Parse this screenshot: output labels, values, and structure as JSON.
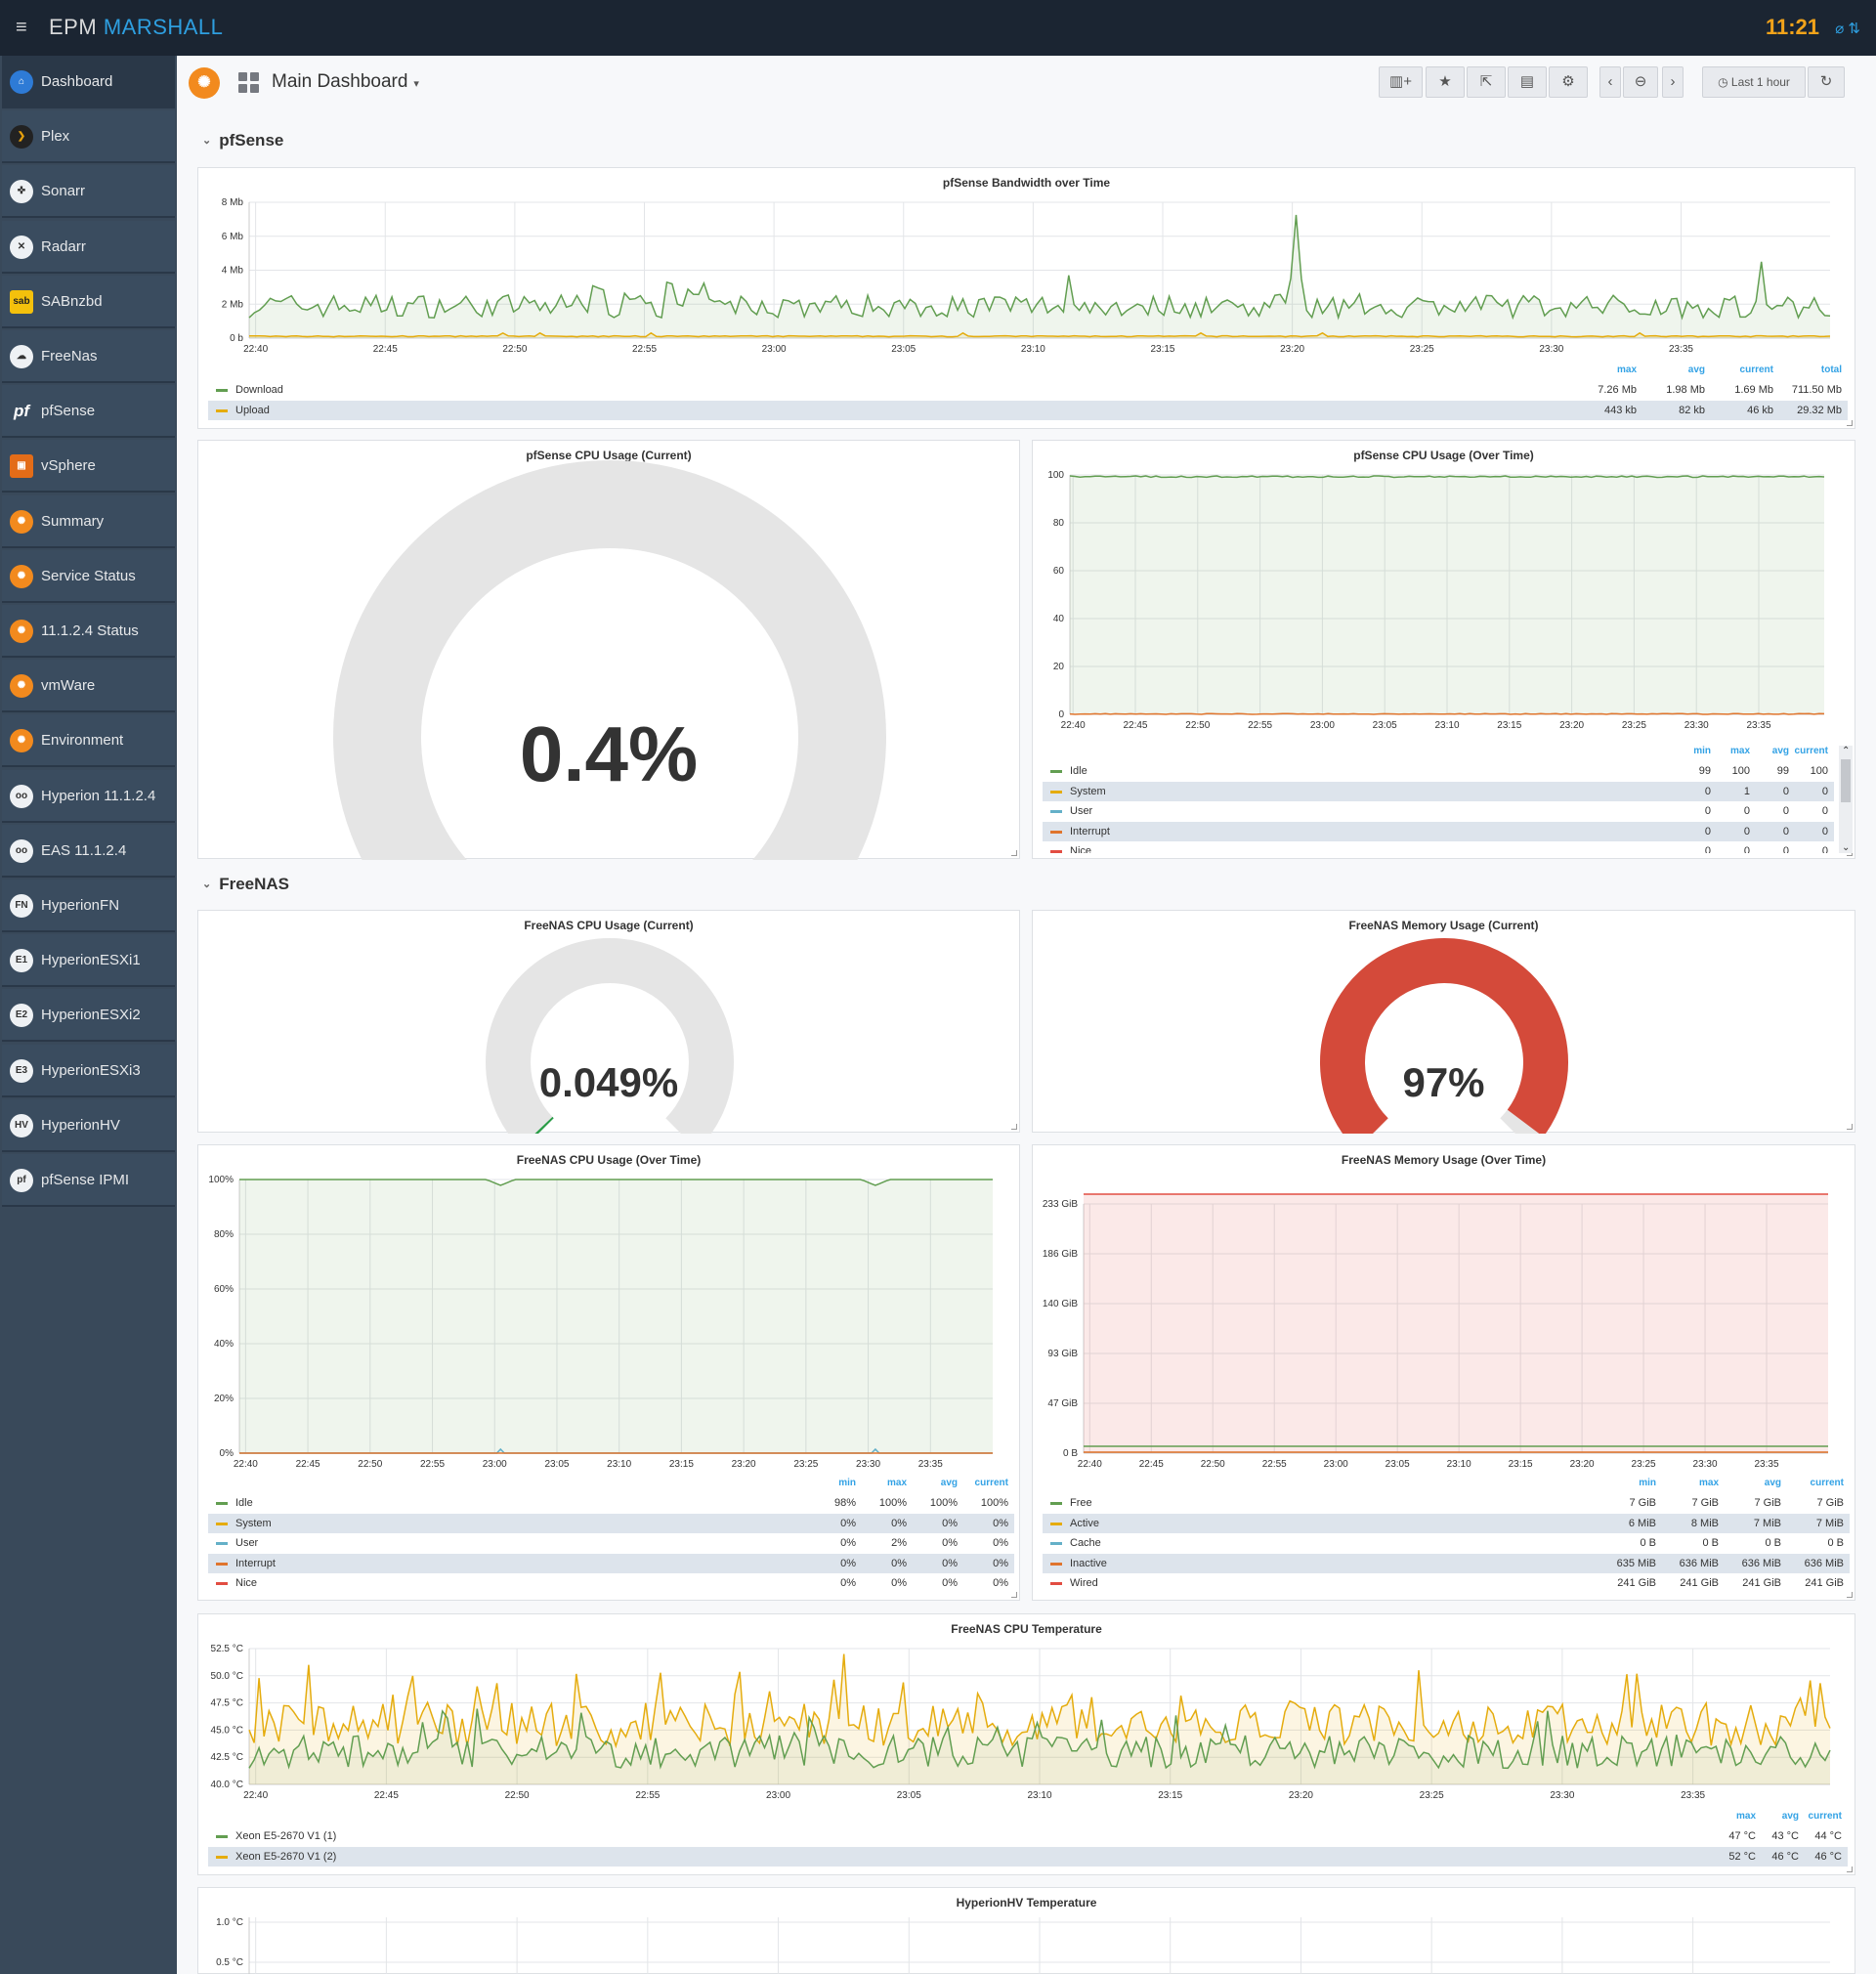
{
  "topbar": {
    "menu_icon": "hamburger-icon",
    "brand_part1": "EPM",
    "brand_part2": "MARSHALL",
    "clock": "11:21",
    "status_icons": "⌀ ⇅"
  },
  "sidebar": {
    "items": [
      {
        "label": "Dashboard",
        "icon": "home-icon",
        "icon_text": "⌂"
      },
      {
        "label": "Plex",
        "icon": "plex-icon",
        "icon_text": "❯"
      },
      {
        "label": "Sonarr",
        "icon": "sonarr-icon",
        "icon_text": "✜"
      },
      {
        "label": "Radarr",
        "icon": "radarr-icon",
        "icon_text": "✕"
      },
      {
        "label": "SABnzbd",
        "icon": "sabnzbd-icon",
        "icon_text": "sab"
      },
      {
        "label": "FreeNas",
        "icon": "freenas-icon",
        "icon_text": "☁"
      },
      {
        "label": "pfSense",
        "icon": "pfsense-icon",
        "icon_text": "pf"
      },
      {
        "label": "vSphere",
        "icon": "vsphere-icon",
        "icon_text": "▣"
      },
      {
        "label": "Summary",
        "icon": "grafana-icon",
        "icon_text": "✺"
      },
      {
        "label": "Service Status",
        "icon": "grafana-icon",
        "icon_text": "✺"
      },
      {
        "label": "11.1.2.4 Status",
        "icon": "grafana-icon",
        "icon_text": "✺"
      },
      {
        "label": "vmWare",
        "icon": "grafana-icon",
        "icon_text": "✺"
      },
      {
        "label": "Environment",
        "icon": "grafana-icon",
        "icon_text": "✺"
      },
      {
        "label": "Hyperion 11.1.2.4",
        "icon": "hyperion-icon",
        "icon_text": "oo"
      },
      {
        "label": "EAS 11.1.2.4",
        "icon": "eas-icon",
        "icon_text": "oo"
      },
      {
        "label": "HyperionFN",
        "icon": "ipmi-icon",
        "icon_text": "FN"
      },
      {
        "label": "HyperionESXi1",
        "icon": "ipmi-icon",
        "icon_text": "E1"
      },
      {
        "label": "HyperionESXi2",
        "icon": "ipmi-icon",
        "icon_text": "E2"
      },
      {
        "label": "HyperionESXi3",
        "icon": "ipmi-icon",
        "icon_text": "E3"
      },
      {
        "label": "HyperionHV",
        "icon": "ipmi-icon",
        "icon_text": "HV"
      },
      {
        "label": "pfSense IPMI",
        "icon": "ipmi-icon",
        "icon_text": "pf"
      }
    ]
  },
  "header": {
    "logo_icon": "grafana-logo-icon",
    "title": "Main Dashboard",
    "caret": "▾",
    "time_range": "Last 1 hour",
    "buttons": [
      {
        "name": "add-panel-button",
        "icon": "add-panel-icon",
        "glyph": "▥+"
      },
      {
        "name": "star-button",
        "icon": "star-icon",
        "glyph": "★"
      },
      {
        "name": "share-button",
        "icon": "share-icon",
        "glyph": "⇱"
      },
      {
        "name": "save-button",
        "icon": "save-icon",
        "glyph": "▤"
      },
      {
        "name": "settings-button",
        "icon": "gear-icon",
        "glyph": "⚙"
      },
      {
        "name": "time-back-button",
        "icon": "chevron-left-icon",
        "glyph": "‹"
      },
      {
        "name": "zoom-out-button",
        "icon": "zoom-out-icon",
        "glyph": "⊖"
      },
      {
        "name": "time-forward-button",
        "icon": "chevron-right-icon",
        "glyph": "›"
      },
      {
        "name": "refresh-button",
        "icon": "refresh-icon",
        "glyph": "↻"
      }
    ],
    "clock_glyph": "◷"
  },
  "rows": {
    "pfsense": "pfSense",
    "freenas": "FreeNAS",
    "chev": "⌄"
  },
  "colors": {
    "green": "#629e51",
    "yellow": "#e5ac0e",
    "cyan": "#64b0c8",
    "orange": "#e0752d",
    "red": "#e24d42",
    "legend_header": "#33a2e5"
  },
  "time_ticks": [
    "22:40",
    "22:45",
    "22:50",
    "22:55",
    "23:00",
    "23:05",
    "23:10",
    "23:15",
    "23:20",
    "23:25",
    "23:30",
    "23:35"
  ],
  "bandwidth": {
    "title": "pfSense Bandwidth over Time",
    "y_ticks": [
      "8 Mb",
      "6 Mb",
      "4 Mb",
      "2 Mb",
      "0 b"
    ],
    "legend_headers": [
      "max",
      "avg",
      "current",
      "total"
    ],
    "series": [
      {
        "name": "Download",
        "color": "#629e51",
        "values": [
          "7.26 Mb",
          "1.98 Mb",
          "1.69 Mb",
          "711.50 Mb"
        ]
      },
      {
        "name": "Upload",
        "color": "#e5ac0e",
        "values": [
          "443 kb",
          "82 kb",
          "46 kb",
          "29.32 Mb"
        ]
      }
    ]
  },
  "pf_cpu_current": {
    "title": "pfSense CPU Usage (Current)",
    "value_text": "0.4%",
    "value": 0.4
  },
  "pf_cpu_time": {
    "title": "pfSense CPU Usage (Over Time)",
    "y_ticks": [
      "100",
      "80",
      "60",
      "40",
      "20",
      "0"
    ],
    "legend_headers": [
      "min",
      "max",
      "avg",
      "current"
    ],
    "series": [
      {
        "name": "Idle",
        "color": "#629e51",
        "values": [
          "99",
          "100",
          "99",
          "100"
        ]
      },
      {
        "name": "System",
        "color": "#e5ac0e",
        "values": [
          "0",
          "1",
          "0",
          "0"
        ]
      },
      {
        "name": "User",
        "color": "#64b0c8",
        "values": [
          "0",
          "0",
          "0",
          "0"
        ]
      },
      {
        "name": "Interrupt",
        "color": "#e0752d",
        "values": [
          "0",
          "0",
          "0",
          "0"
        ]
      },
      {
        "name": "Nice",
        "color": "#e24d42",
        "values": [
          "0",
          "0",
          "0",
          "0"
        ]
      }
    ],
    "scroll_up": "⌃",
    "scroll_down": "⌄"
  },
  "fn_cpu_current": {
    "title": "FreeNAS CPU Usage (Current)",
    "value_text": "0.049%",
    "value": 0.049
  },
  "fn_mem_current": {
    "title": "FreeNAS Memory Usage (Current)",
    "value_text": "97%",
    "value": 97
  },
  "fn_cpu_time": {
    "title": "FreeNAS CPU Usage (Over Time)",
    "y_ticks": [
      "100%",
      "80%",
      "60%",
      "40%",
      "20%",
      "0%"
    ],
    "legend_headers": [
      "min",
      "max",
      "avg",
      "current"
    ],
    "series": [
      {
        "name": "Idle",
        "color": "#629e51",
        "values": [
          "98%",
          "100%",
          "100%",
          "100%"
        ]
      },
      {
        "name": "System",
        "color": "#e5ac0e",
        "values": [
          "0%",
          "0%",
          "0%",
          "0%"
        ]
      },
      {
        "name": "User",
        "color": "#64b0c8",
        "values": [
          "0%",
          "2%",
          "0%",
          "0%"
        ]
      },
      {
        "name": "Interrupt",
        "color": "#e0752d",
        "values": [
          "0%",
          "0%",
          "0%",
          "0%"
        ]
      },
      {
        "name": "Nice",
        "color": "#e24d42",
        "values": [
          "0%",
          "0%",
          "0%",
          "0%"
        ]
      }
    ]
  },
  "fn_mem_time": {
    "title": "FreeNAS Memory Usage (Over Time)",
    "y_ticks": [
      "233 GiB",
      "186 GiB",
      "140 GiB",
      "93 GiB",
      "47 GiB",
      "0 B"
    ],
    "legend_headers": [
      "min",
      "max",
      "avg",
      "current"
    ],
    "series": [
      {
        "name": "Free",
        "color": "#629e51",
        "values": [
          "7 GiB",
          "7 GiB",
          "7 GiB",
          "7 GiB"
        ]
      },
      {
        "name": "Active",
        "color": "#e5ac0e",
        "values": [
          "6 MiB",
          "8 MiB",
          "7 MiB",
          "7 MiB"
        ]
      },
      {
        "name": "Cache",
        "color": "#64b0c8",
        "values": [
          "0 B",
          "0 B",
          "0 B",
          "0 B"
        ]
      },
      {
        "name": "Inactive",
        "color": "#e0752d",
        "values": [
          "635 MiB",
          "636 MiB",
          "636 MiB",
          "636 MiB"
        ]
      },
      {
        "name": "Wired",
        "color": "#e24d42",
        "values": [
          "241 GiB",
          "241 GiB",
          "241 GiB",
          "241 GiB"
        ]
      }
    ]
  },
  "fn_temp": {
    "title": "FreeNAS CPU Temperature",
    "y_ticks": [
      "52.5 °C",
      "50.0 °C",
      "47.5 °C",
      "45.0 °C",
      "42.5 °C",
      "40.0 °C"
    ],
    "legend_headers": [
      "max",
      "avg",
      "current"
    ],
    "series": [
      {
        "name": "Xeon E5-2670 V1 (1)",
        "color": "#629e51",
        "values": [
          "47 °C",
          "43 °C",
          "44 °C"
        ]
      },
      {
        "name": "Xeon E5-2670 V1 (2)",
        "color": "#e5ac0e",
        "values": [
          "52 °C",
          "46 °C",
          "46 °C"
        ]
      }
    ]
  },
  "hv_temp": {
    "title": "HyperionHV Temperature",
    "y_ticks": [
      "1.0 °C",
      "0.5 °C"
    ]
  }
}
